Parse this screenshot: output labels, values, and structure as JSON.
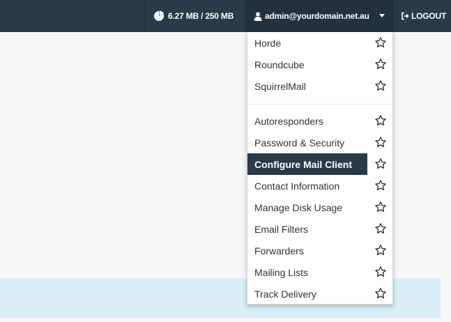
{
  "topbar": {
    "disk_usage": "6.27 MB / 250 MB",
    "user_email": "admin@yourdomain.net.au",
    "logout_label": "LOGOUT"
  },
  "dropdown": {
    "webmail": [
      {
        "label": "Horde"
      },
      {
        "label": "Roundcube"
      },
      {
        "label": "SquirrelMail"
      }
    ],
    "tools": [
      {
        "label": "Autoresponders"
      },
      {
        "label": "Password & Security"
      },
      {
        "label": "Configure Mail Client",
        "active": true
      },
      {
        "label": "Contact Information"
      },
      {
        "label": "Manage Disk Usage"
      },
      {
        "label": "Email Filters"
      },
      {
        "label": "Forwarders"
      },
      {
        "label": "Mailing Lists"
      },
      {
        "label": "Track Delivery"
      }
    ]
  },
  "colors": {
    "topbar": "#293a4a",
    "active_item": "#293a4a",
    "info_band": "#d9edf7"
  }
}
